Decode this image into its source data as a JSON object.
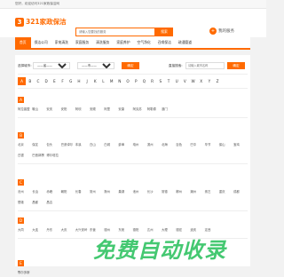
{
  "topbar": {
    "text": "您好，欢迎访问321家政保洁网"
  },
  "header": {
    "logo_mark": "3",
    "logo_text": "321家政保洁",
    "search_placeholder": "请输入您要找的服务",
    "search_button": "搜索",
    "publish_icon": "+",
    "publish_label": "我的服务"
  },
  "nav": {
    "items": [
      {
        "label": "首页",
        "active": true
      },
      {
        "label": "保洁公司"
      },
      {
        "label": "家电清洗"
      },
      {
        "label": "家庭服务"
      },
      {
        "label": "清洗服务"
      },
      {
        "label": "家庭养护"
      },
      {
        "label": "空气净化"
      },
      {
        "label": "召唤保洁"
      },
      {
        "label": "疏通管道"
      }
    ]
  },
  "filter": {
    "province_label": "选择城市:",
    "province_value": "——省——",
    "city_value": "——市——",
    "confirm_button": "确定",
    "search_label": "直接搜索:",
    "search_placeholder": "请输入城市名称",
    "search_button": "确定"
  },
  "letters": [
    "A",
    "B",
    "C",
    "D",
    "E",
    "F",
    "G",
    "H",
    "J",
    "K",
    "L",
    "M",
    "N",
    "O",
    "P",
    "Q",
    "R",
    "S",
    "T",
    "U",
    "V",
    "W",
    "X",
    "Y",
    "Z"
  ],
  "active_letter": "A",
  "groups": [
    {
      "letter": "A",
      "cities": [
        "阿拉善盟",
        "鞍山",
        "安庆",
        "安阳",
        "阿坝",
        "安顺",
        "阿里",
        "安康",
        "阿克苏",
        "阿勒泰",
        "澳门"
      ]
    },
    {
      "letter": "B",
      "cities": [
        "北京",
        "保定",
        "包头",
        "巴彦淖尔",
        "本溪",
        "白山",
        "白城",
        "蚌埠",
        "亳州",
        "滨州",
        "北海",
        "百色",
        "巴中",
        "毕节",
        "保山",
        "宝鸡",
        "白银",
        "巴音郭楞",
        "博尔塔拉"
      ]
    },
    {
      "letter": "C",
      "cities": [
        "沧州",
        "长治",
        "赤峰",
        "朝阳",
        "长春",
        "常州",
        "滁州",
        "巢湖",
        "池州",
        "长沙",
        "常德",
        "郴州",
        "潮州",
        "崇左",
        "重庆",
        "成都",
        "楚雄",
        "昌都",
        "昌吉"
      ]
    },
    {
      "letter": "D",
      "cities": [
        "大同",
        "大连",
        "丹东",
        "大庆",
        "大兴安岭",
        "东营",
        "德州",
        "东莞",
        "德阳",
        "达州",
        "大理",
        "德宏",
        "迪庆",
        "定西"
      ]
    },
    {
      "letter": "E",
      "cities": [
        "鄂尔多斯"
      ]
    }
  ],
  "watermark": "免费自动收录",
  "colors": {
    "accent": "#ff6a00",
    "watermark": "#3bc66a"
  }
}
